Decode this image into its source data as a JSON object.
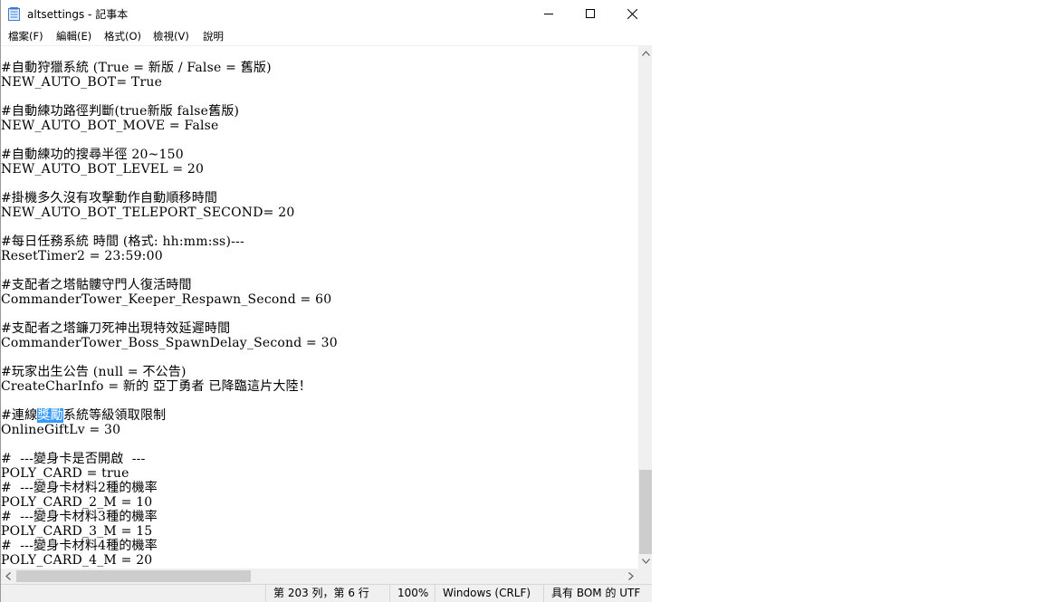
{
  "window": {
    "title": "altsettings - 記事本",
    "controls": {
      "minimize": "minimize-icon",
      "maximize": "maximize-icon",
      "close": "close-icon"
    }
  },
  "menu": [
    "檔案(F)",
    "編輯(E)",
    "格式(O)",
    "檢視(V)",
    "說明"
  ],
  "editor": {
    "lines": [
      "#自動狩獵系統 (True = 新版 / False = 舊版)",
      "NEW_AUTO_BOT= True",
      "",
      "#自動練功路徑判斷(true新版 false舊版)",
      "NEW_AUTO_BOT_MOVE = False",
      "",
      "#自動練功的搜尋半徑 20~150",
      "NEW_AUTO_BOT_LEVEL = 20",
      "",
      "#掛機多久沒有攻擊動作自動順移時間",
      "NEW_AUTO_BOT_TELEPORT_SECOND= 20",
      "",
      "#每日任務系統 時間 (格式: hh:mm:ss)---",
      "ResetTimer2 = 23:59:00",
      "",
      "#支配者之塔骷髏守門人復活時間",
      "CommanderTower_Keeper_Respawn_Second = 60",
      "",
      "#支配者之塔鐮刀死神出現特效延遲時間",
      "CommanderTower_Boss_SpawnDelay_Second = 30",
      "",
      "#玩家出生公告 (null = 不公告)",
      "CreateCharInfo = 新的 亞丁勇者 已降臨這片大陸！",
      "",
      "#連線獎勵系統等級領取限制",
      "OnlineGiftLv = 30",
      "",
      "#  ---變身卡是否開啟  ---",
      "POLY_CARD = true",
      "#  ---變身卡材料2種的機率",
      "POLY_CARD_2_M = 10",
      "#  ---變身卡材料3種的機率",
      "POLY_CARD_3_M = 15",
      "#  ---變身卡材料4種的機率",
      "POLY_CARD_4_M = 20"
    ],
    "selection": {
      "line_index": 24,
      "before": "#連線",
      "selected": "獎勵",
      "after": "系統等級領取限制"
    }
  },
  "status": {
    "position": "第 203 列，第 6 行",
    "zoom": "100%",
    "line_ending": "Windows (CRLF)",
    "encoding": "具有 BOM 的 UTF"
  }
}
